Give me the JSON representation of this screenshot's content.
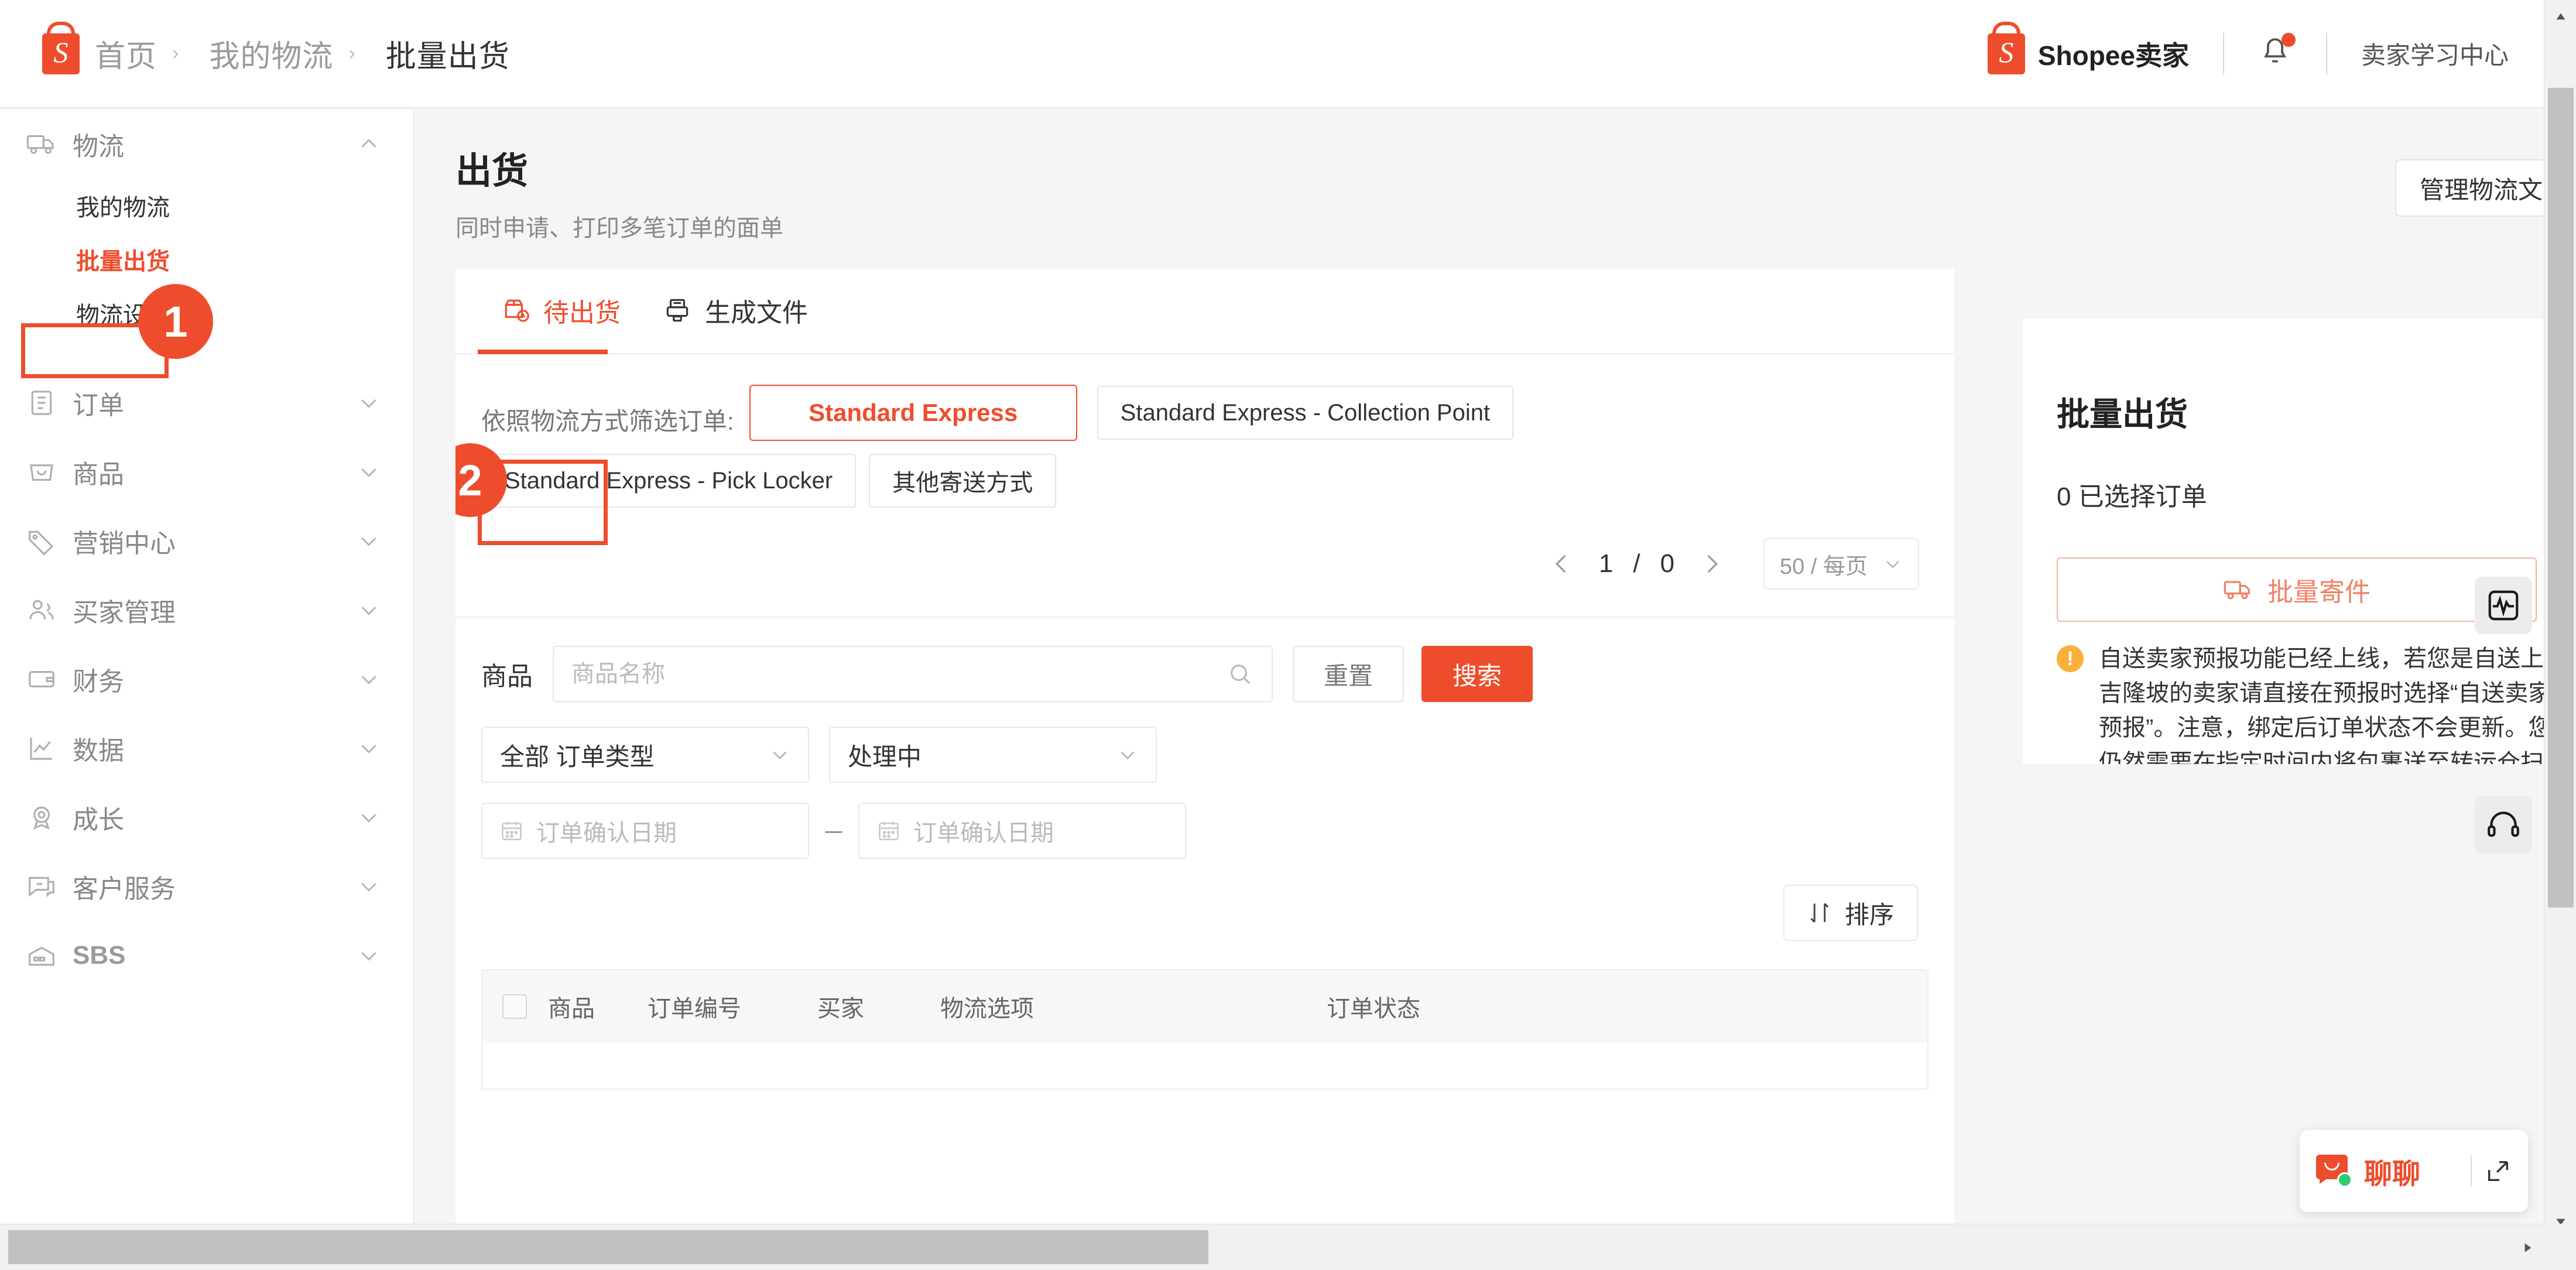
{
  "header": {
    "breadcrumb": [
      "首页",
      "我的物流",
      "批量出货"
    ],
    "brand": "Shopee卖家",
    "learning_center": "卖家学习中心",
    "notification_badge": true
  },
  "sidebar": {
    "groups": [
      {
        "label": "物流",
        "icon": "truck-icon",
        "expanded": true,
        "chevron": "chevron-up-icon",
        "items": [
          {
            "label": "我的物流",
            "active": false
          },
          {
            "label": "批量出货",
            "active": true
          },
          {
            "label": "物流设置",
            "active": false
          }
        ]
      },
      {
        "label": "订单",
        "icon": "clipboard-icon",
        "expanded": false,
        "chevron": "chevron-down-icon",
        "items": []
      },
      {
        "label": "商品",
        "icon": "bag-icon",
        "expanded": false,
        "chevron": "chevron-down-icon",
        "items": []
      },
      {
        "label": "营销中心",
        "icon": "tag-icon",
        "expanded": false,
        "chevron": "chevron-down-icon",
        "items": []
      },
      {
        "label": "买家管理",
        "icon": "users-icon",
        "expanded": false,
        "chevron": "chevron-down-icon",
        "items": []
      },
      {
        "label": "财务",
        "icon": "wallet-icon",
        "expanded": false,
        "chevron": "chevron-down-icon",
        "items": []
      },
      {
        "label": "数据",
        "icon": "chart-line-icon",
        "expanded": false,
        "chevron": "chevron-down-icon",
        "items": []
      },
      {
        "label": "成长",
        "icon": "medal-icon",
        "expanded": false,
        "chevron": "chevron-down-icon",
        "items": []
      },
      {
        "label": "客户服务",
        "icon": "chat-icon",
        "expanded": false,
        "chevron": "chevron-down-icon",
        "items": []
      },
      {
        "label": "SBS",
        "icon": "warehouse-icon",
        "expanded": false,
        "chevron": "chevron-down-icon",
        "items": []
      }
    ]
  },
  "annotations": [
    {
      "number": "1",
      "target": "sidebar-item-批量出货"
    },
    {
      "number": "2",
      "target": "tab-待出货"
    }
  ],
  "page": {
    "title": "出货",
    "subtitle": "同时申请、打印多笔订单的面单",
    "manage_button": "管理物流文"
  },
  "tabs": [
    {
      "label": "待出货",
      "icon": "package-clock-icon",
      "active": true
    },
    {
      "label": "生成文件",
      "icon": "printer-icon",
      "active": false
    }
  ],
  "filters": {
    "label": "依照物流方式筛选订单:",
    "chips": [
      {
        "label": "Standard Express",
        "selected": true
      },
      {
        "label": "Standard Express - Collection Point",
        "selected": false
      },
      {
        "label": "Standard Express - Pick Locker",
        "selected": false
      },
      {
        "label": "其他寄送方式",
        "selected": false
      }
    ]
  },
  "pagination": {
    "prev_icon": "chevron-left-icon",
    "next_icon": "chevron-right-icon",
    "current_page": "1",
    "separator": "/",
    "total_pages": "0",
    "page_size": "50 / 每页",
    "page_size_chevron": "chevron-down-icon"
  },
  "search": {
    "label": "商品",
    "placeholder": "商品名称",
    "value": "",
    "icon": "search-icon",
    "reset_label": "重置",
    "submit_label": "搜索"
  },
  "selects": [
    {
      "value": "全部 订单类型",
      "name": "order-type"
    },
    {
      "value": "处理中",
      "name": "order-status"
    }
  ],
  "date_range": {
    "start_placeholder": "订单确认日期",
    "end_placeholder": "订单确认日期",
    "dash": "－",
    "icon": "calendar-icon"
  },
  "sort_button": {
    "label": "排序",
    "icon": "sort-icon"
  },
  "table": {
    "columns": [
      "商品",
      "订单编号",
      "买家",
      "物流选项",
      "订单状态"
    ],
    "rows": [],
    "select_all_checked": false
  },
  "right_panel": {
    "title": "批量出货",
    "selected_count_text": "0 已选择订单",
    "bulk_ship_button": "批量寄件",
    "bulk_ship_icon": "truck-icon",
    "notice_icon": "warning-icon",
    "notice": "自送卖家预报功能已经上线，若您是自送上去吉隆坡的卖家请直接在预报时选择“自送卖家预报”。注意，绑定后订单状态不会更新。您仍然需要在指定时间内将包裹送至转运仓扫描。"
  },
  "float_icons": [
    {
      "name": "activity-monitor-icon"
    },
    {
      "name": "headset-support-icon"
    }
  ],
  "chat_widget": {
    "label": "聊聊",
    "icon": "chat-bubble-icon",
    "online": true,
    "expand_icon": "expand-icon"
  },
  "colors": {
    "accent": "#ee4d2d",
    "warning": "#fbb03b",
    "online": "#2ecc71",
    "text": "#333333",
    "muted": "#999999"
  }
}
